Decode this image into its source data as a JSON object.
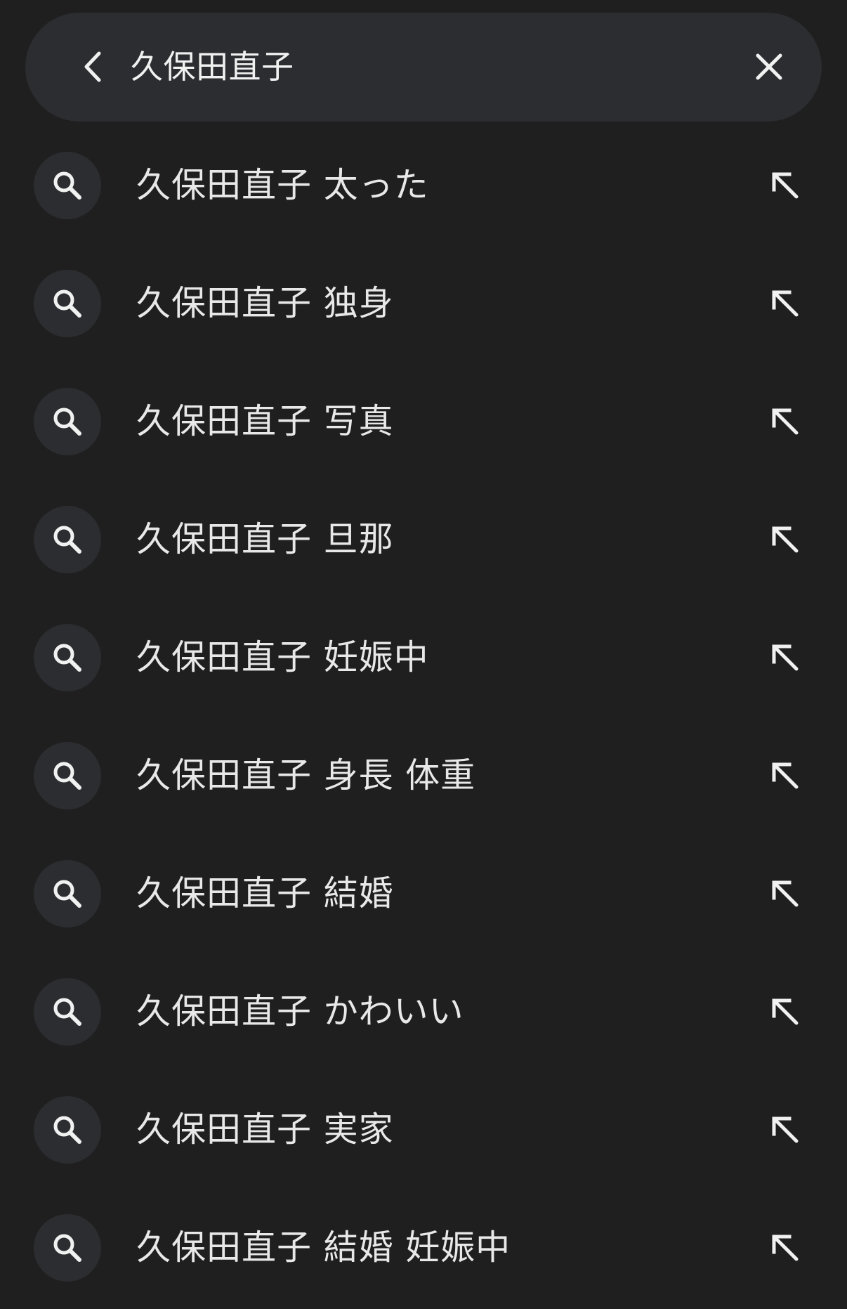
{
  "search": {
    "query": "久保田直子",
    "back_icon": "chevron-left-icon",
    "clear_icon": "close-icon"
  },
  "suggestions": [
    {
      "text": "久保田直子 太った"
    },
    {
      "text": "久保田直子 独身"
    },
    {
      "text": "久保田直子 写真"
    },
    {
      "text": "久保田直子 旦那"
    },
    {
      "text": "久保田直子 妊娠中"
    },
    {
      "text": "久保田直子 身長 体重"
    },
    {
      "text": "久保田直子 結婚"
    },
    {
      "text": "久保田直子 かわいい"
    },
    {
      "text": "久保田直子 実家"
    },
    {
      "text": "久保田直子 結婚 妊娠中"
    }
  ],
  "icons": {
    "suggestion_icon": "search-icon",
    "fill_icon": "arrow-up-left-icon"
  },
  "colors": {
    "background": "#1f1f1f",
    "search_bar": "#2c2d30",
    "text": "#e8e8e8",
    "icon": "#f1f1f1"
  }
}
